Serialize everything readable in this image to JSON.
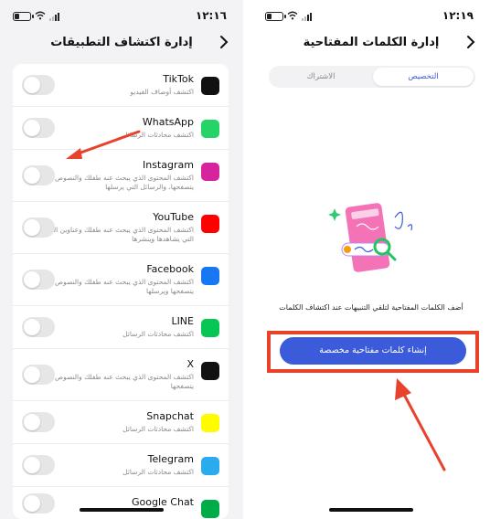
{
  "left": {
    "time": "١٢:١٦",
    "title": "إدارة اكتشاف التطبيقات",
    "back_icon": "chevron-right",
    "apps": [
      {
        "name": "TikTok",
        "desc": "اكتشف أوصاف الفيديو",
        "icon": "tiktok-icon",
        "color": "#111111"
      },
      {
        "name": "WhatsApp",
        "desc": "اكتشف محادثات الرسائل",
        "icon": "whatsapp-icon",
        "color": "#25d366"
      },
      {
        "name": "Instagram",
        "desc": "اكتشف المحتوى الذي يبحث عنه طفلك والنصوص التي يتصفحها، والرسائل التي يرسلها",
        "icon": "instagram-icon",
        "color": "#d6249f"
      },
      {
        "name": "YouTube",
        "desc": "اكتشف المحتوى الذي يبحث عنه طفلك وعناوين الفيديوهات التي يشاهدها وينشرها",
        "icon": "youtube-icon",
        "color": "#ff0000"
      },
      {
        "name": "Facebook",
        "desc": "اكتشف المحتوى الذي يبحث عنه طفلك والنصوص التي يتصفحها ويرسلها",
        "icon": "facebook-icon",
        "color": "#1877f2"
      },
      {
        "name": "LINE",
        "desc": "اكتشف محادثات الرسائل",
        "icon": "line-icon",
        "color": "#06c755"
      },
      {
        "name": "X",
        "desc": "اكتشف المحتوى الذي يبحث عنه طفلك والنصوص التي يتصفحها",
        "icon": "x-icon",
        "color": "#111111"
      },
      {
        "name": "Snapchat",
        "desc": "اكتشف محادثات الرسائل",
        "icon": "snapchat-icon",
        "color": "#fffc00"
      },
      {
        "name": "Telegram",
        "desc": "اكتشف محادثات الرسائل",
        "icon": "telegram-icon",
        "color": "#2aabee"
      },
      {
        "name": "Google Chat",
        "desc": "",
        "icon": "google-chat-icon",
        "color": "#00ac47"
      }
    ]
  },
  "right": {
    "time": "١٢:١٩",
    "title": "إدارة الكلمات المفتاحية",
    "back_icon": "chevron-right",
    "tabs": {
      "active": "التخصيص",
      "inactive": "الاشتراك"
    },
    "empty_text": "أضف الكلمات المفتاحية لتلقي التنبيهات عند اكتشاف الكلمات",
    "cta": "إنشاء كلمات مفتاحية مخصصة"
  },
  "colors": {
    "accent": "#3b5bdb",
    "highlight": "#e8412c"
  }
}
